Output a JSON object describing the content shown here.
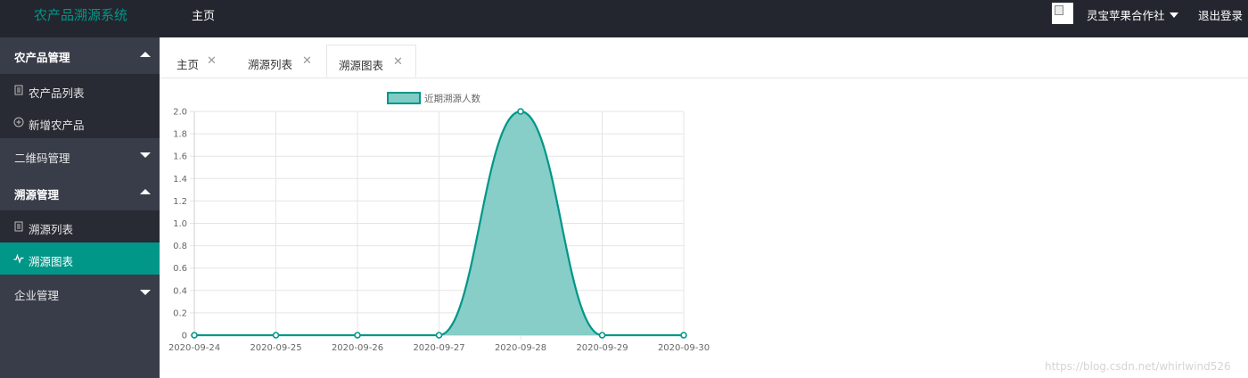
{
  "header": {
    "brand": "农产品溯源系统",
    "home_link": "主页",
    "user_name": "灵宝苹果合作社",
    "logout": "退出登录"
  },
  "sidebar": {
    "groups": [
      {
        "label": "农产品管理",
        "expanded": true,
        "items": [
          {
            "label": "农产品列表",
            "icon": "list-icon"
          },
          {
            "label": "新增农产品",
            "icon": "plus-circle-icon"
          }
        ]
      },
      {
        "label": "二维码管理",
        "expanded": false,
        "items": []
      },
      {
        "label": "溯源管理",
        "expanded": true,
        "items": [
          {
            "label": "溯源列表",
            "icon": "list-icon"
          },
          {
            "label": "溯源图表",
            "icon": "pulse-icon",
            "active": true
          }
        ]
      },
      {
        "label": "企业管理",
        "expanded": false,
        "items": []
      }
    ]
  },
  "tabs": [
    {
      "label": "主页",
      "active": false
    },
    {
      "label": "溯源列表",
      "active": false
    },
    {
      "label": "溯源图表",
      "active": true
    }
  ],
  "chart_data": {
    "type": "area",
    "x": [
      "2020-09-24",
      "2020-09-25",
      "2020-09-26",
      "2020-09-27",
      "2020-09-28",
      "2020-09-29",
      "2020-09-30"
    ],
    "series": [
      {
        "name": "近期溯源人数",
        "values": [
          0,
          0,
          0,
          0,
          2,
          0,
          0
        ]
      }
    ],
    "ylim": [
      0,
      2.0
    ],
    "yticks": [
      "0",
      "0.2",
      "0.4",
      "0.6",
      "0.8",
      "1.0",
      "1.2",
      "1.4",
      "1.6",
      "1.8",
      "2.0"
    ],
    "grid": true,
    "legend": "top",
    "colors": {
      "line": "#009688",
      "fill": "#80cbc4"
    }
  },
  "watermark": "https://blog.csdn.net/whirlwind526",
  "colors": {
    "accent": "#009688",
    "header_bg": "#23262e",
    "sidebar_bg": "#393d49",
    "submenu_bg": "#282b33"
  }
}
